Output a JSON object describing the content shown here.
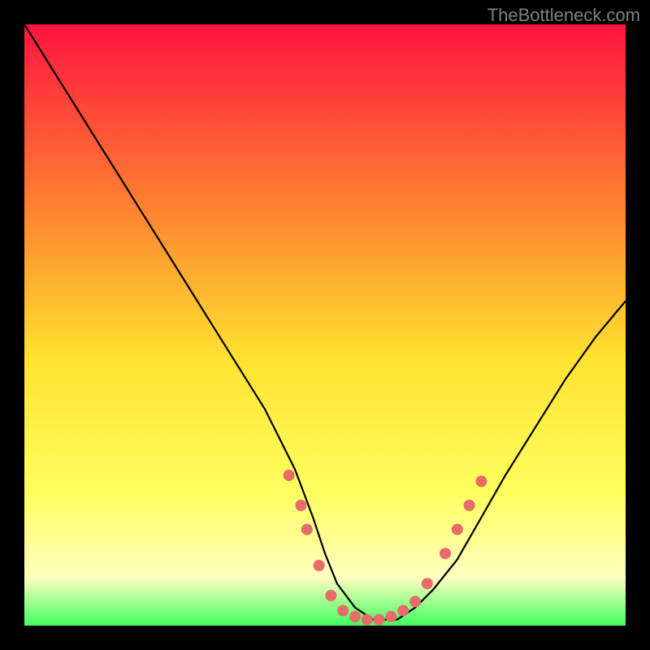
{
  "watermark": "TheBottleneck.com",
  "chart_data": {
    "type": "line",
    "title": "",
    "xlabel": "",
    "ylabel": "",
    "xlim": [
      0,
      100
    ],
    "ylim": [
      0,
      100
    ],
    "gradient_colors": {
      "top": "#ff1440",
      "mid_upper": "#ff8030",
      "mid": "#ffe030",
      "mid_lower": "#ffff60",
      "lower": "#ffffc0",
      "bottom": "#40ff60"
    },
    "curve": {
      "description": "V-shaped bottleneck curve: steep descent from top-left, minimum around x=55-60, rise to mid-right",
      "x": [
        0,
        5,
        10,
        15,
        20,
        25,
        30,
        35,
        40,
        45,
        48,
        50,
        52,
        55,
        58,
        60,
        62,
        65,
        68,
        72,
        76,
        80,
        85,
        90,
        95,
        100
      ],
      "y": [
        100,
        92,
        84,
        76,
        68,
        60,
        52,
        44,
        36,
        26,
        18,
        12,
        7,
        3,
        1,
        1,
        1,
        3,
        6,
        11,
        18,
        25,
        33,
        41,
        48,
        54
      ]
    },
    "markers": {
      "description": "Salmon/coral dots near the curve minimum region",
      "color": "#e86a6a",
      "points": [
        {
          "x": 44,
          "y": 25
        },
        {
          "x": 46,
          "y": 20
        },
        {
          "x": 47,
          "y": 16
        },
        {
          "x": 49,
          "y": 10
        },
        {
          "x": 51,
          "y": 5
        },
        {
          "x": 53,
          "y": 2.5
        },
        {
          "x": 55,
          "y": 1.5
        },
        {
          "x": 57,
          "y": 1
        },
        {
          "x": 59,
          "y": 1
        },
        {
          "x": 61,
          "y": 1.5
        },
        {
          "x": 63,
          "y": 2.5
        },
        {
          "x": 65,
          "y": 4
        },
        {
          "x": 67,
          "y": 7
        },
        {
          "x": 70,
          "y": 12
        },
        {
          "x": 72,
          "y": 16
        },
        {
          "x": 74,
          "y": 20
        },
        {
          "x": 76,
          "y": 24
        }
      ]
    }
  }
}
